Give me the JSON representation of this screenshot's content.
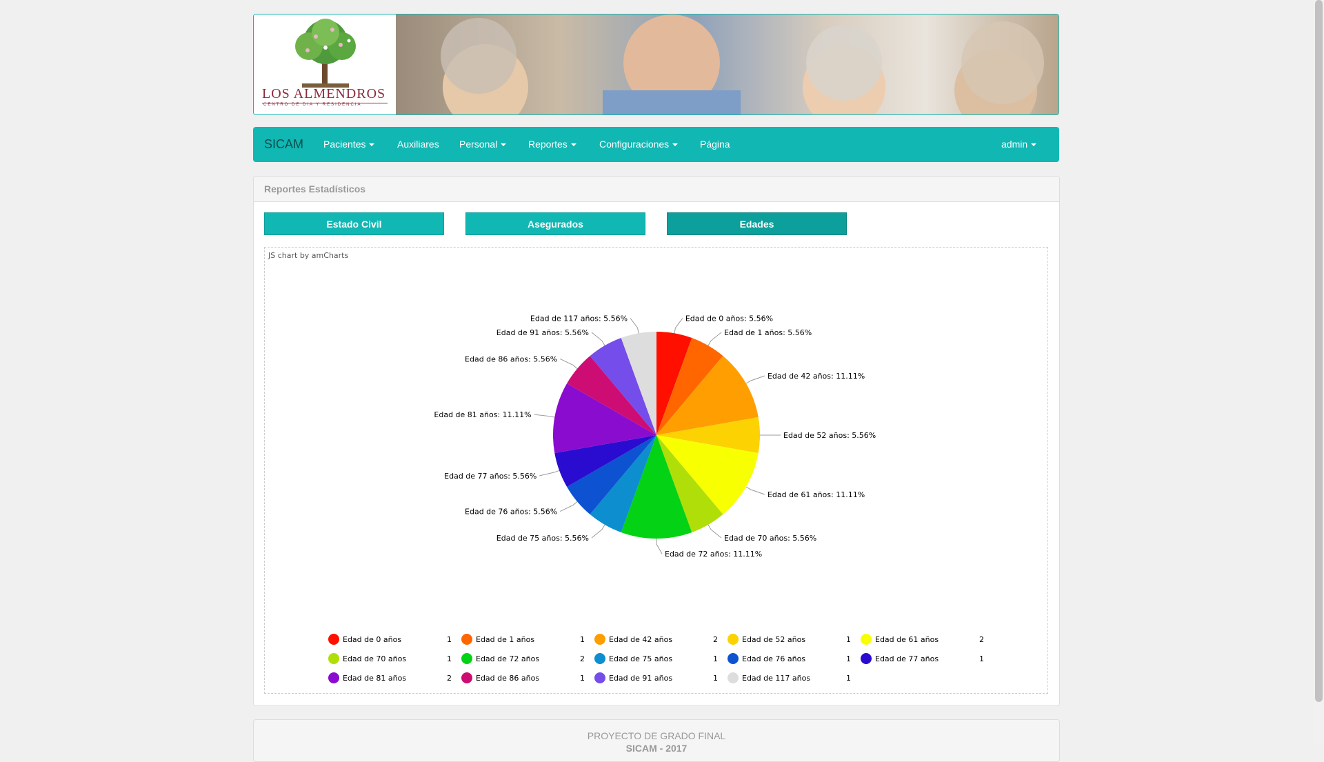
{
  "header": {
    "logo_title": "LOS ALMENDROS",
    "logo_subtitle": "CENTRO DE DIA Y RESIDENCIA"
  },
  "navbar": {
    "brand": "SICAM",
    "items": [
      {
        "label": "Pacientes",
        "dropdown": true
      },
      {
        "label": "Auxiliares",
        "dropdown": false
      },
      {
        "label": "Personal",
        "dropdown": true
      },
      {
        "label": "Reportes",
        "dropdown": true
      },
      {
        "label": "Configuraciones",
        "dropdown": true
      },
      {
        "label": "Página",
        "dropdown": false
      }
    ],
    "user": "admin"
  },
  "panel": {
    "title": "Reportes Estadísticos",
    "tabs": [
      {
        "label": "Estado Civil",
        "active": false
      },
      {
        "label": "Asegurados",
        "active": false
      },
      {
        "label": "Edades",
        "active": true
      }
    ],
    "chart_credit": "JS chart by amCharts"
  },
  "chart_data": {
    "type": "pie",
    "slices": [
      {
        "label": "Edad de 0 años",
        "value": 1,
        "percent": "5.56%",
        "color": "#ff0f00"
      },
      {
        "label": "Edad de 1 años",
        "value": 1,
        "percent": "5.56%",
        "color": "#ff6600"
      },
      {
        "label": "Edad de 42 años",
        "value": 2,
        "percent": "11.11%",
        "color": "#ff9e01"
      },
      {
        "label": "Edad de 52 años",
        "value": 1,
        "percent": "5.56%",
        "color": "#fcd202"
      },
      {
        "label": "Edad de 61 años",
        "value": 2,
        "percent": "11.11%",
        "color": "#f8ff01"
      },
      {
        "label": "Edad de 70 años",
        "value": 1,
        "percent": "5.56%",
        "color": "#b0de09"
      },
      {
        "label": "Edad de 72 años",
        "value": 2,
        "percent": "11.11%",
        "color": "#04d215"
      },
      {
        "label": "Edad de 75 años",
        "value": 1,
        "percent": "5.56%",
        "color": "#0d8ecf"
      },
      {
        "label": "Edad de 76 años",
        "value": 1,
        "percent": "5.56%",
        "color": "#0d52d1"
      },
      {
        "label": "Edad de 77 años",
        "value": 1,
        "percent": "5.56%",
        "color": "#2a0cd0"
      },
      {
        "label": "Edad de 81 años",
        "value": 2,
        "percent": "11.11%",
        "color": "#8a0ccf"
      },
      {
        "label": "Edad de 86 años",
        "value": 1,
        "percent": "5.56%",
        "color": "#cd0d74"
      },
      {
        "label": "Edad de 91 años",
        "value": 1,
        "percent": "5.56%",
        "color": "#754deb"
      },
      {
        "label": "Edad de 117 años",
        "value": 1,
        "percent": "5.56%",
        "color": "#dddddd"
      }
    ],
    "legend_placement": "bottom"
  },
  "footer": {
    "line1": "PROYECTO DE GRADO FINAL",
    "line2": "SICAM - 2017"
  }
}
